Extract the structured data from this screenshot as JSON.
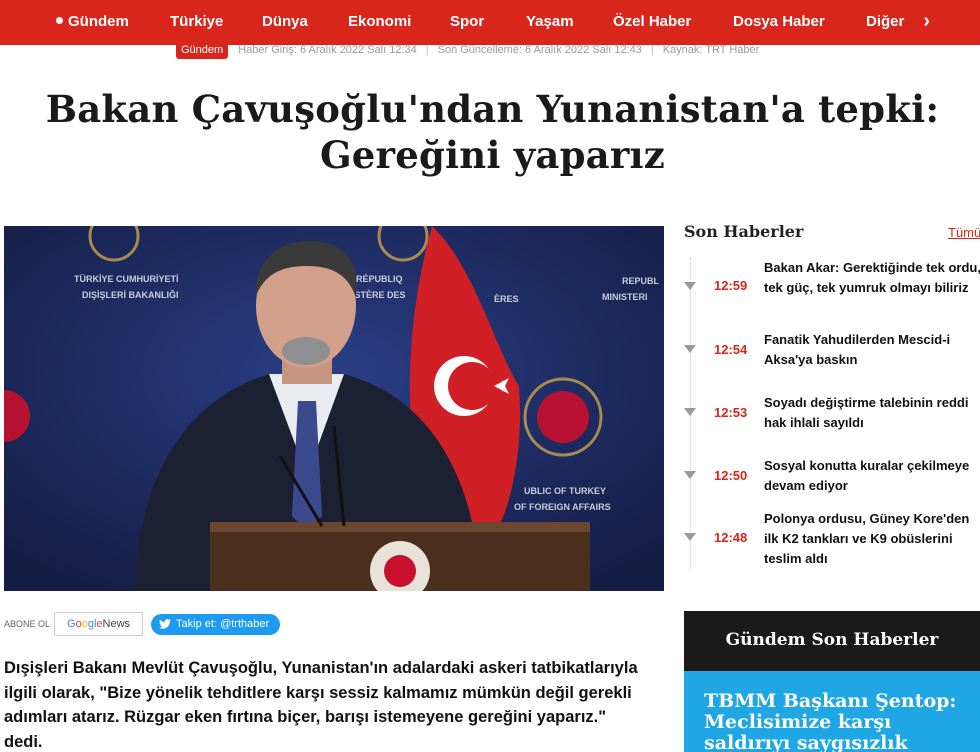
{
  "nav": {
    "items": [
      "Gündem",
      "Türkiye",
      "Dünya",
      "Ekonomi",
      "Spor",
      "Yaşam",
      "Özel Haber",
      "Dosya Haber",
      "Diğer"
    ],
    "active_index": 0,
    "bg_color": "#d9261c"
  },
  "meta": {
    "category": "Gündem",
    "published": "Haber Giriş: 6 Aralık 2022 Salı 12:34",
    "updated": "Son Güncelleme: 6 Aralık 2022 Salı 12:43",
    "source": "Kaynak: TRT Haber"
  },
  "article": {
    "headline_line1": "Bakan Çavuşoğlu'ndan Yunanistan'a tepki:",
    "headline_line2": "Gereğini yaparız",
    "lead": "Dışişleri Bakanı Mevlüt Çavuşoğlu, Yunanistan'ın adalardaki askeri tatbikatlarıyla ilgili olarak, \"Bize yönelik tehditlere karşı sessiz kalmamız mümkün değil gerekli adımları atarız. Rüzgar eken fırtına biçer, barışı istemeyene gereğini yaparız.\" dedi."
  },
  "hero_image": {
    "backdrop_left_1": "TÜRKİYE CUMHURİYETİ",
    "backdrop_left_2": "DIŞİŞLERİ BAKANLIĞI",
    "backdrop_mid_1": "RÉPUBLIQ",
    "backdrop_mid_2": "ISTÈRE DES",
    "backdrop_mid_3": "ÈRES",
    "backdrop_right_1": "REPUBL",
    "backdrop_right_2": "MINISTERI",
    "backdrop_low_1": "UBLIC OF TURKEY",
    "backdrop_low_2": "OF FOREIGN AFFAIRS"
  },
  "share": {
    "abone": "ABONE OL",
    "google_news_g": [
      "G",
      "o",
      "o",
      "g",
      "l",
      "e"
    ],
    "google_news_label": " News",
    "twitter_label": "Takip et: @trthaber"
  },
  "sidebar": {
    "title": "Son Haberler",
    "all_link": "Tümü",
    "items": [
      {
        "time": "12:59",
        "text": "Bakan Akar: Gerektiğinde tek ordu, tek güç, tek yumruk olmayı biliriz"
      },
      {
        "time": "12:54",
        "text": "Fanatik Yahudilerden Mescid-i Aksa'ya baskın"
      },
      {
        "time": "12:53",
        "text": "Soyadı değiştirme talebinin reddi hak ihlali sayıldı"
      },
      {
        "time": "12:50",
        "text": "Sosyal konutta kuralar çekilmeye devam ediyor"
      },
      {
        "time": "12:48",
        "text": "Polonya ordusu, Güney Kore'den ilk K2 tankları ve K9 obüslerini teslim aldı"
      }
    ],
    "gundem_title": "Gündem Son Haberler",
    "gundem_card_text": "TBMM Başkanı Şentop: Meclisimize karşı saldırıyı saygısızlık"
  }
}
